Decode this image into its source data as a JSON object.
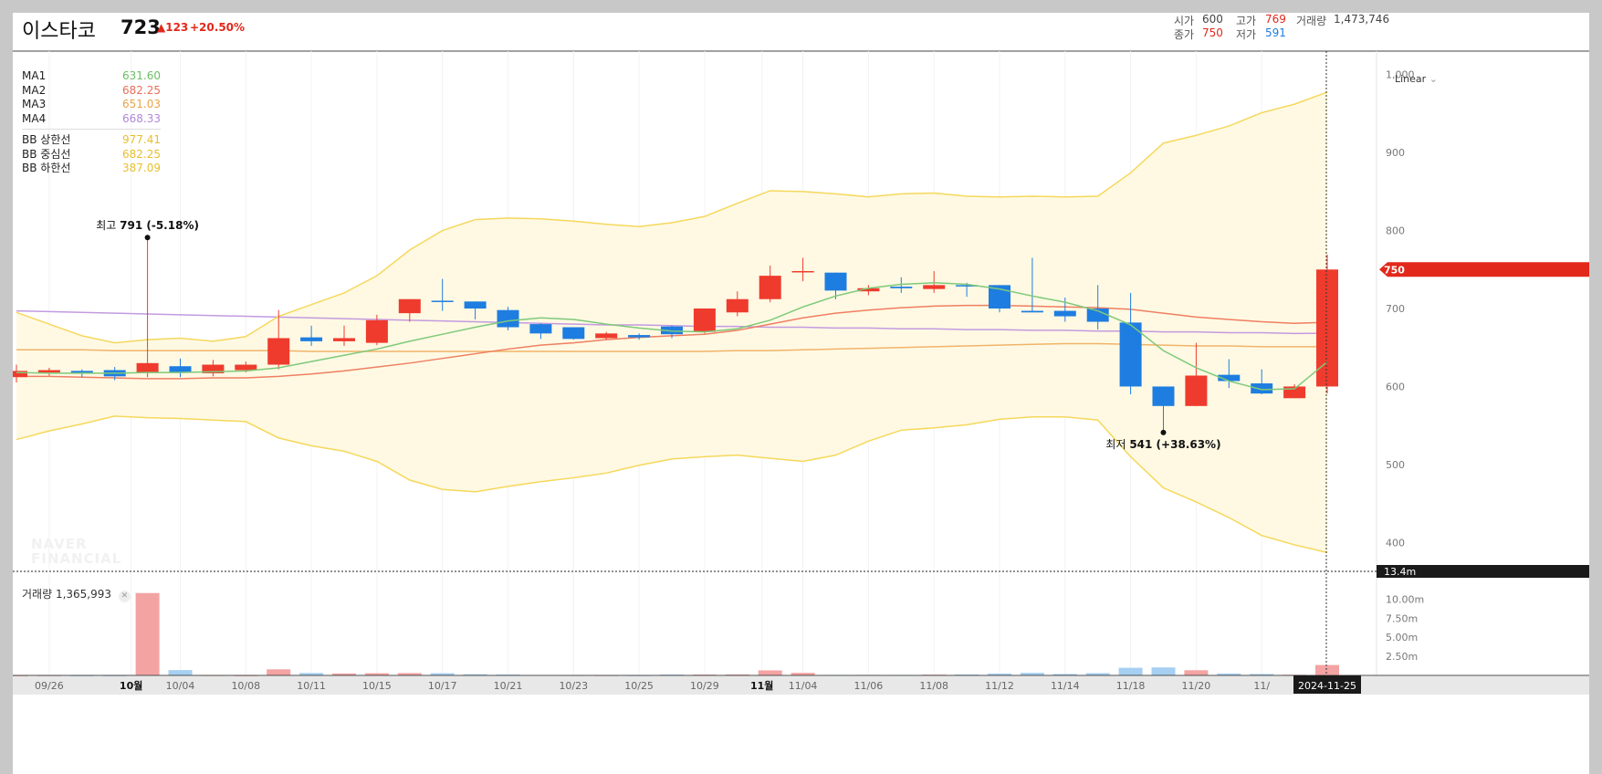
{
  "header": {
    "name": "이스타코",
    "price": "723",
    "change": "▲123",
    "change_pct": "+20.50%",
    "open_label": "시가",
    "open": "600",
    "high_label": "고가",
    "high": "769",
    "volume_label": "거래량",
    "volume": "1,473,746",
    "close_label": "종가",
    "close": "750",
    "low_label": "저가",
    "low": "591"
  },
  "legend": {
    "ma1_label": "MA1",
    "ma1": "631.60",
    "ma2_label": "MA2",
    "ma2": "682.25",
    "ma3_label": "MA3",
    "ma3": "651.03",
    "ma4_label": "MA4",
    "ma4": "668.33",
    "bb_upper_label": "BB 상한선",
    "bb_upper": "977.41",
    "bb_mid_label": "BB 중심선",
    "bb_mid": "682.25",
    "bb_lower_label": "BB 하한선",
    "bb_lower": "387.09"
  },
  "scale_mode": "Linear",
  "watermark": [
    "NAVER",
    "FINANCIAL"
  ],
  "volume_panel": {
    "label": "거래량",
    "value": "1,365,993",
    "close_icon": "close-icon"
  },
  "colors": {
    "up": "#ef3b2d",
    "down": "#1e7de0",
    "ma1": "#7ec97a",
    "ma2": "#ef7f62",
    "ma3": "#f0b469",
    "ma4": "#c39be0",
    "bb": "#f5d85c",
    "bb_fill": "#fff9e3",
    "vol_up": "#f4a3a3",
    "vol_down": "#a6cff2"
  },
  "chart_data": {
    "type": "candlestick",
    "ylim": [
      370,
      1030
    ],
    "y_ticks": [
      1000,
      900,
      800,
      700,
      600,
      500,
      400
    ],
    "y_tick_labels": [
      "1,000",
      "900",
      "800",
      "700",
      "600",
      "500",
      "400"
    ],
    "price_badge": "750",
    "x_tick_labels": [
      {
        "i": 1,
        "label": "09/26",
        "bold": false
      },
      {
        "i": 3.5,
        "label": "10월",
        "bold": true
      },
      {
        "i": 5,
        "label": "10/04",
        "bold": false
      },
      {
        "i": 7,
        "label": "10/08",
        "bold": false
      },
      {
        "i": 9,
        "label": "10/11",
        "bold": false
      },
      {
        "i": 11,
        "label": "10/15",
        "bold": false
      },
      {
        "i": 13,
        "label": "10/17",
        "bold": false
      },
      {
        "i": 15,
        "label": "10/21",
        "bold": false
      },
      {
        "i": 17,
        "label": "10/23",
        "bold": false
      },
      {
        "i": 19,
        "label": "10/25",
        "bold": false
      },
      {
        "i": 21,
        "label": "10/29",
        "bold": false
      },
      {
        "i": 22.75,
        "label": "11월",
        "bold": true
      },
      {
        "i": 24,
        "label": "11/04",
        "bold": false
      },
      {
        "i": 26,
        "label": "11/06",
        "bold": false
      },
      {
        "i": 28,
        "label": "11/08",
        "bold": false
      },
      {
        "i": 30,
        "label": "11/12",
        "bold": false
      },
      {
        "i": 32,
        "label": "11/14",
        "bold": false
      },
      {
        "i": 34,
        "label": "11/18",
        "bold": false
      },
      {
        "i": 36,
        "label": "11/20",
        "bold": false
      },
      {
        "i": 38,
        "label": "11/",
        "bold": false
      }
    ],
    "cursor_date": "2024-11-25",
    "candles": [
      {
        "o": 612,
        "h": 628,
        "l": 605,
        "c": 620
      },
      {
        "o": 618,
        "h": 624,
        "l": 614,
        "c": 621
      },
      {
        "o": 620,
        "h": 622,
        "l": 612,
        "c": 617
      },
      {
        "o": 621,
        "h": 625,
        "l": 608,
        "c": 613
      },
      {
        "o": 618,
        "h": 791,
        "l": 612,
        "c": 630
      },
      {
        "o": 626,
        "h": 636,
        "l": 612,
        "c": 618
      },
      {
        "o": 617,
        "h": 634,
        "l": 613,
        "c": 628
      },
      {
        "o": 621,
        "h": 632,
        "l": 618,
        "c": 628
      },
      {
        "o": 628,
        "h": 698,
        "l": 622,
        "c": 662
      },
      {
        "o": 663,
        "h": 678,
        "l": 652,
        "c": 658
      },
      {
        "o": 658,
        "h": 678,
        "l": 652,
        "c": 662
      },
      {
        "o": 656,
        "h": 692,
        "l": 653,
        "c": 685
      },
      {
        "o": 694,
        "h": 712,
        "l": 683,
        "c": 712
      },
      {
        "o": 710,
        "h": 738,
        "l": 697,
        "c": 709
      },
      {
        "o": 709,
        "h": 709,
        "l": 686,
        "c": 700
      },
      {
        "o": 698,
        "h": 702,
        "l": 672,
        "c": 676
      },
      {
        "o": 680,
        "h": 681,
        "l": 661,
        "c": 668
      },
      {
        "o": 676,
        "h": 676,
        "l": 660,
        "c": 661
      },
      {
        "o": 662,
        "h": 670,
        "l": 660,
        "c": 668
      },
      {
        "o": 666,
        "h": 668,
        "l": 660,
        "c": 663
      },
      {
        "o": 677,
        "h": 678,
        "l": 662,
        "c": 667
      },
      {
        "o": 670,
        "h": 700,
        "l": 668,
        "c": 700
      },
      {
        "o": 695,
        "h": 722,
        "l": 690,
        "c": 712
      },
      {
        "o": 712,
        "h": 755,
        "l": 708,
        "c": 742
      },
      {
        "o": 748,
        "h": 765,
        "l": 735,
        "c": 748
      },
      {
        "o": 746,
        "h": 746,
        "l": 712,
        "c": 723
      },
      {
        "o": 722,
        "h": 730,
        "l": 717,
        "c": 726
      },
      {
        "o": 728,
        "h": 740,
        "l": 720,
        "c": 726
      },
      {
        "o": 725,
        "h": 748,
        "l": 720,
        "c": 730
      },
      {
        "o": 730,
        "h": 733,
        "l": 715,
        "c": 729
      },
      {
        "o": 730,
        "h": 730,
        "l": 695,
        "c": 700
      },
      {
        "o": 697,
        "h": 765,
        "l": 695,
        "c": 695
      },
      {
        "o": 697,
        "h": 714,
        "l": 683,
        "c": 690
      },
      {
        "o": 700,
        "h": 730,
        "l": 673,
        "c": 683
      },
      {
        "o": 682,
        "h": 720,
        "l": 590,
        "c": 600
      },
      {
        "o": 600,
        "h": 600,
        "l": 541,
        "c": 575
      },
      {
        "o": 575,
        "h": 656,
        "l": 575,
        "c": 614
      },
      {
        "o": 615,
        "h": 635,
        "l": 598,
        "c": 607
      },
      {
        "o": 604,
        "h": 622,
        "l": 590,
        "c": 591
      },
      {
        "o": 585,
        "h": 603,
        "l": 585,
        "c": 600
      },
      {
        "o": 600,
        "h": 769,
        "l": 591,
        "c": 750
      }
    ],
    "series": [
      {
        "name": "MA1",
        "values": [
          618,
          617,
          617,
          617,
          618,
          618,
          619,
          620,
          624,
          632,
          640,
          648,
          658,
          667,
          676,
          684,
          688,
          686,
          680,
          675,
          671,
          670,
          674,
          685,
          702,
          716,
          726,
          731,
          733,
          731,
          725,
          716,
          708,
          697,
          679,
          646,
          624,
          607,
          596,
          597,
          631.6
        ]
      },
      {
        "name": "MA2",
        "values": [
          613,
          613,
          612,
          611,
          610,
          610,
          611,
          611,
          613,
          616,
          620,
          625,
          630,
          636,
          642,
          648,
          653,
          656,
          660,
          663,
          665,
          667,
          672,
          680,
          688,
          694,
          698,
          701,
          703,
          704,
          704,
          703,
          702,
          701,
          699,
          694,
          689,
          686,
          683,
          681,
          682.25
        ]
      },
      {
        "name": "MA3",
        "values": [
          647,
          647,
          647,
          646,
          646,
          646,
          646,
          646,
          646,
          645,
          645,
          645,
          645,
          645,
          645,
          645,
          645,
          645,
          645,
          645,
          645,
          645,
          646,
          646,
          647,
          648,
          649,
          650,
          651,
          652,
          653,
          654,
          655,
          655,
          654,
          653,
          652,
          652,
          651,
          651,
          651.03
        ]
      },
      {
        "name": "MA4",
        "values": [
          697,
          696,
          695,
          694,
          693,
          692,
          691,
          690,
          689,
          688,
          687,
          686,
          685,
          684,
          683,
          682,
          681,
          680,
          679,
          679,
          678,
          677,
          677,
          676,
          676,
          675,
          675,
          674,
          674,
          673,
          673,
          672,
          672,
          671,
          671,
          670,
          670,
          669,
          669,
          668,
          668.33
        ]
      },
      {
        "name": "BB 상한선",
        "values": [
          695,
          680,
          665,
          656,
          660,
          662,
          658,
          664,
          690,
          705,
          720,
          742,
          775,
          800,
          814,
          816,
          815,
          812,
          808,
          805,
          810,
          818,
          835,
          851,
          850,
          847,
          843,
          847,
          848,
          844,
          843,
          844,
          843,
          844,
          874,
          912,
          922,
          934,
          951,
          962,
          977.41
        ]
      },
      {
        "name": "BB 하한선",
        "values": [
          532,
          543,
          552,
          562,
          560,
          559,
          557,
          555,
          534,
          524,
          517,
          504,
          480,
          468,
          465,
          472,
          478,
          483,
          489,
          499,
          507,
          510,
          512,
          508,
          504,
          512,
          530,
          544,
          547,
          551,
          558,
          561,
          561,
          557,
          510,
          470,
          452,
          432,
          409,
          397,
          387.09
        ]
      }
    ],
    "volume": {
      "ylim": [
        0,
        13400000
      ],
      "y_ticks": [
        10000000,
        7500000,
        5000000,
        2500000
      ],
      "y_tick_labels": [
        "10.00m",
        "7.50m",
        "5.00m",
        "2.50m"
      ],
      "max_badge": "13.4m",
      "values": [
        20000,
        30000,
        20000,
        25000,
        10800000,
        700000,
        40000,
        25000,
        800000,
        320000,
        260000,
        290000,
        310000,
        290000,
        150000,
        110000,
        60000,
        50000,
        40000,
        40000,
        110000,
        110000,
        130000,
        660000,
        340000,
        70000,
        70000,
        70000,
        100000,
        120000,
        240000,
        340000,
        190000,
        300000,
        1000000,
        1050000,
        680000,
        250000,
        190000,
        90000,
        1365993
      ]
    },
    "annotations": [
      {
        "type": "high",
        "label": "최고",
        "value": "791",
        "pct": "(-5.18%)",
        "index": 4,
        "price": 791
      },
      {
        "type": "low",
        "label": "최저",
        "value": "541",
        "pct": "(+38.63%)",
        "index": 35,
        "price": 541
      }
    ]
  }
}
